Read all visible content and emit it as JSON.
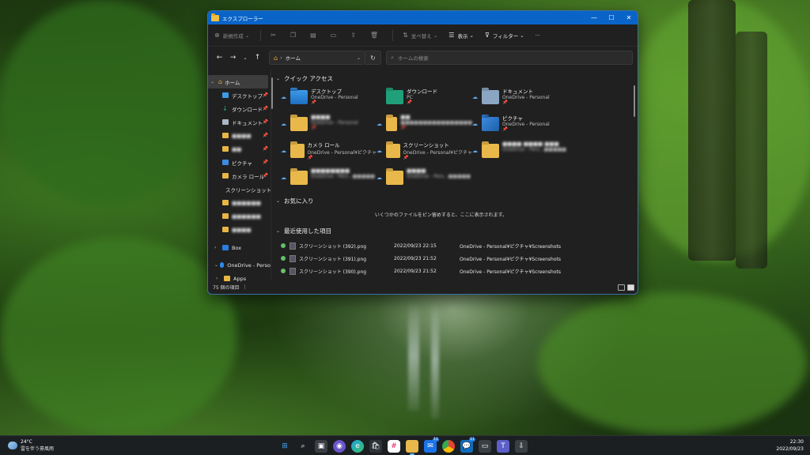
{
  "window": {
    "title": "エクスプローラー",
    "controls": [
      "—",
      "☐",
      "✕"
    ]
  },
  "toolbar": {
    "new": "新規作成",
    "sort": "並べ替え",
    "view": "表示",
    "filter": "フィルター",
    "more": "···"
  },
  "nav": {
    "address": "ホーム",
    "search_placeholder": "ホームの検索"
  },
  "sidebar": {
    "home": "ホーム",
    "items": [
      {
        "label": "デスクトップ",
        "pinned": true
      },
      {
        "label": "ダウンロード",
        "pinned": true
      },
      {
        "label": "ドキュメント",
        "pinned": true
      },
      {
        "label": "■■■■",
        "pinned": true
      },
      {
        "label": "■■",
        "pinned": true
      },
      {
        "label": "ピクチャ",
        "pinned": true
      },
      {
        "label": "カメラ ロール",
        "pinned": true
      },
      {
        "label": "スクリーンショット",
        "pinned": false
      },
      {
        "label": "■■■■■■",
        "pinned": false
      },
      {
        "label": "■■■■■■",
        "pinned": false
      },
      {
        "label": "■■■■",
        "pinned": false
      }
    ],
    "box": "Box",
    "onedrive": "OneDrive - Perso",
    "apps": "Apps"
  },
  "quick_access": {
    "header": "クイック アクセス",
    "items": [
      {
        "name": "デスクトップ",
        "sub": "OneDrive - Personal"
      },
      {
        "name": "ダウンロード",
        "sub": "PC"
      },
      {
        "name": "ドキュメント",
        "sub": "OneDrive - Personal"
      },
      {
        "name": "■■■■",
        "sub": "OneDrive - Personal"
      },
      {
        "name": "■■",
        "sub": "■■■■■■■■■■■■■■■■"
      },
      {
        "name": "ピクチャ",
        "sub": "OneDrive - Personal"
      },
      {
        "name": "カメラ ロール",
        "sub": "OneDrive - Personal¥ピクチャ"
      },
      {
        "name": "スクリーンショット",
        "sub": "OneDrive - Personal¥ピクチャ"
      },
      {
        "name": "■■■■ ■■■■ ■■■",
        "sub": "OneDrive - Pers...■■■■■"
      },
      {
        "name": "■■■■■■■■",
        "sub": "OneDrive - Pers...■■■■■"
      },
      {
        "name": "■■■■",
        "sub": "OneDrive - Pers...■■■■■"
      }
    ]
  },
  "favorites": {
    "header": "お気に入り",
    "empty_message": "いくつかのファイルをピン留めすると、ここに表示されます。"
  },
  "recent": {
    "header": "最近使用した項目",
    "rows": [
      {
        "name": "スクリーンショット (392).png",
        "date": "2022/09/23 22:15",
        "location": "OneDrive - Personal¥ピクチャ¥Screenshots"
      },
      {
        "name": "スクリーンショット (391).png",
        "date": "2022/09/23 21:52",
        "location": "OneDrive - Personal¥ピクチャ¥Screenshots"
      },
      {
        "name": "スクリーンショット (390).png",
        "date": "2022/09/23 21:52",
        "location": "OneDrive - Personal¥ピクチャ¥Screenshots"
      }
    ]
  },
  "status": {
    "count": "75 個の項目"
  },
  "taskbar": {
    "weather_temp": "24°C",
    "weather_desc": "雷を伴う豪風雨",
    "time": "22:30",
    "date": "2022/09/23",
    "badges": {
      "mail": "11",
      "msg": "11"
    }
  }
}
